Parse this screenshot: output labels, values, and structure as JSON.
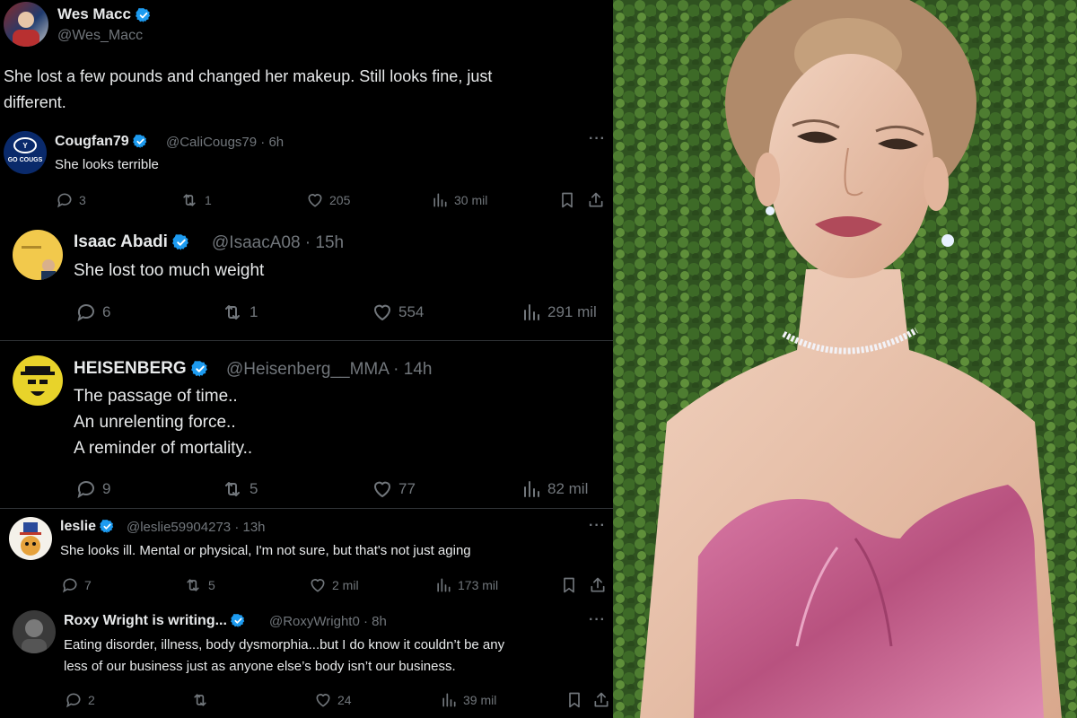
{
  "original_post": {
    "author": "Wes Macc",
    "handle": "@Wes_Macc",
    "text_line1": "She lost a few pounds and changed her makeup. Still looks fine, just",
    "text_line2": "different."
  },
  "replies": [
    {
      "author": "Cougfan79",
      "meta": "@CaliCougs79 · 6h",
      "avatar_text": "GO COUGS",
      "lines": [
        "She looks terrible"
      ],
      "replies": "3",
      "reposts": "1",
      "likes": "205",
      "views": "30 mil"
    },
    {
      "author": "Isaac Abadi",
      "meta": "@IsaacA08 · 15h",
      "lines": [
        "She lost too much weight"
      ],
      "replies": "6",
      "reposts": "1",
      "likes": "554",
      "views": "291 mil"
    },
    {
      "author": "HEISENBERG",
      "meta": "@Heisenberg__MMA · 14h",
      "lines": [
        "The passage of time..",
        "An unrelenting force..",
        "A reminder of mortality.."
      ],
      "replies": "9",
      "reposts": "5",
      "likes": "77",
      "views": "82 mil"
    },
    {
      "author": "leslie",
      "meta": "@leslie59904273 · 13h",
      "lines": [
        "She looks ill. Mental or physical, I'm not sure, but that's not just aging"
      ],
      "replies": "7",
      "reposts": "5",
      "likes": "2 mil",
      "views": "173 mil"
    },
    {
      "author": "Roxy Wright is writing...",
      "meta": "@RoxyWright0 · 8h",
      "lines": [
        "Eating disorder, illness, body dysmorphia...but I do know it couldn’t be any",
        "less of our business just as anyone else’s body isn’t our business."
      ],
      "replies": "2",
      "reposts": "",
      "likes": "24",
      "views": "39 mil"
    }
  ],
  "more_label": "···",
  "colors": {
    "background": "#000000",
    "primary_text": "#e7e9ea",
    "secondary_text": "#71767b",
    "verified": "#1d9bf0",
    "divider": "#2f3336",
    "dress": "#c85a8a",
    "hedge": "#3f6b2a"
  },
  "icons": [
    "verified-badge-icon",
    "reply-icon",
    "repost-icon",
    "like-icon",
    "views-icon",
    "bookmark-icon",
    "share-icon",
    "more-icon"
  ]
}
